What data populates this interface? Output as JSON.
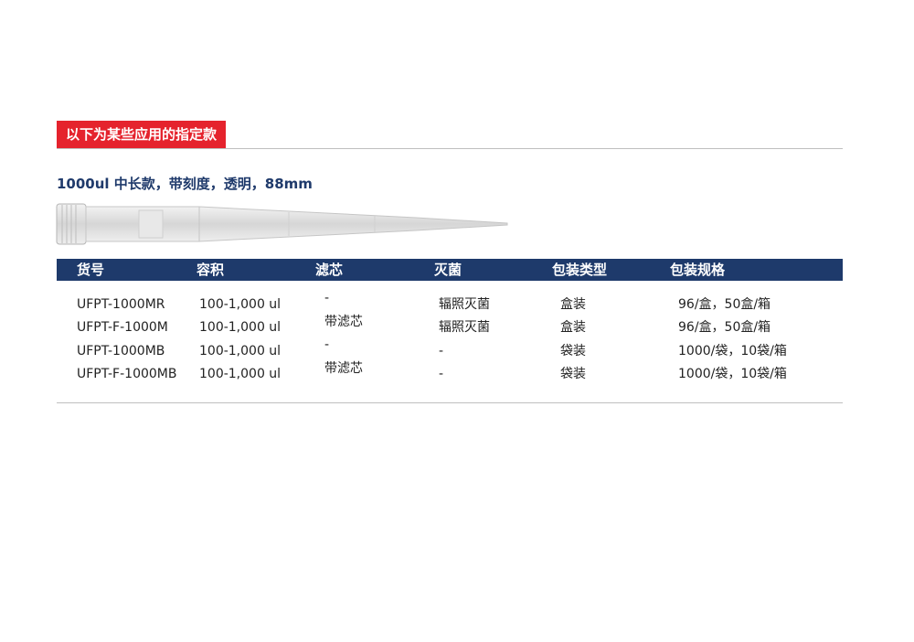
{
  "section_tag": "以下为某些应用的指定款",
  "product_subtitle": "1000ul 中长款，带刻度，透明，88mm",
  "table": {
    "headers": [
      "货号",
      "容积",
      "滤芯",
      "灭菌",
      "包装类型",
      "包装规格"
    ],
    "rows": [
      {
        "item_no": "UFPT-1000MR",
        "volume": "100-1,000 ul",
        "filter": "-",
        "sterile": "辐照灭菌",
        "pack_type": "盒装",
        "pack_spec": "96/盒，50盒/箱"
      },
      {
        "item_no": "UFPT-F-1000M",
        "volume": "100-1,000 ul",
        "filter": "带滤芯",
        "sterile": "辐照灭菌",
        "pack_type": "盒装",
        "pack_spec": "96/盒，50盒/箱"
      },
      {
        "item_no": "UFPT-1000MB",
        "volume": "100-1,000 ul",
        "filter": "-",
        "sterile": "-",
        "pack_type": "袋装",
        "pack_spec": "1000/袋，10袋/箱"
      },
      {
        "item_no": "UFPT-F-1000MB",
        "volume": "100-1,000 ul",
        "filter": "带滤芯",
        "sterile": "-",
        "pack_type": "袋装",
        "pack_spec": "1000/袋，10袋/箱"
      }
    ]
  },
  "colors": {
    "tag_red": "#e5232d",
    "header_navy": "#1e3a6b",
    "subtitle_blue": "#1f3a6b"
  }
}
